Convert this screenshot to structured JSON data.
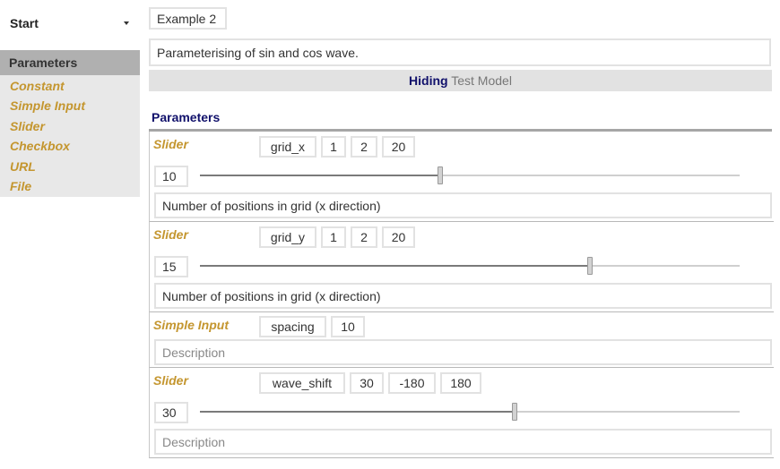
{
  "sidebar": {
    "start_label": "Start",
    "parameters_label": "Parameters",
    "types": [
      "Constant",
      "Simple Input",
      "Slider",
      "Checkbox",
      "URL",
      "File"
    ]
  },
  "example": {
    "title": "Example 2",
    "description": "Parameterising of sin and cos wave."
  },
  "hiding_bar": {
    "hiding": "Hiding",
    "model": "Test Model"
  },
  "parameters_heading": "Parameters",
  "colors": {
    "type_label": "#c4962f",
    "heading": "#11116b",
    "sidebar_head": "#b0b0b0",
    "sidebar_list": "#e8e8e8"
  },
  "params": [
    {
      "type": "Slider",
      "name": "grid_x",
      "step": "1",
      "min": "2",
      "max": "20",
      "value": "10",
      "fraction": 0.4444,
      "description": "Number of positions in grid (x direction)"
    },
    {
      "type": "Slider",
      "name": "grid_y",
      "step": "1",
      "min": "2",
      "max": "20",
      "value": "15",
      "fraction": 0.7222,
      "description": "Number of positions in grid (x direction)"
    },
    {
      "type": "Simple Input",
      "name": "spacing",
      "value": "10",
      "description_placeholder": "Description"
    },
    {
      "type": "Slider",
      "name": "wave_shift",
      "step": "30",
      "min": "-180",
      "max": "180",
      "value": "30",
      "fraction": 0.5833,
      "description_placeholder": "Description"
    }
  ]
}
